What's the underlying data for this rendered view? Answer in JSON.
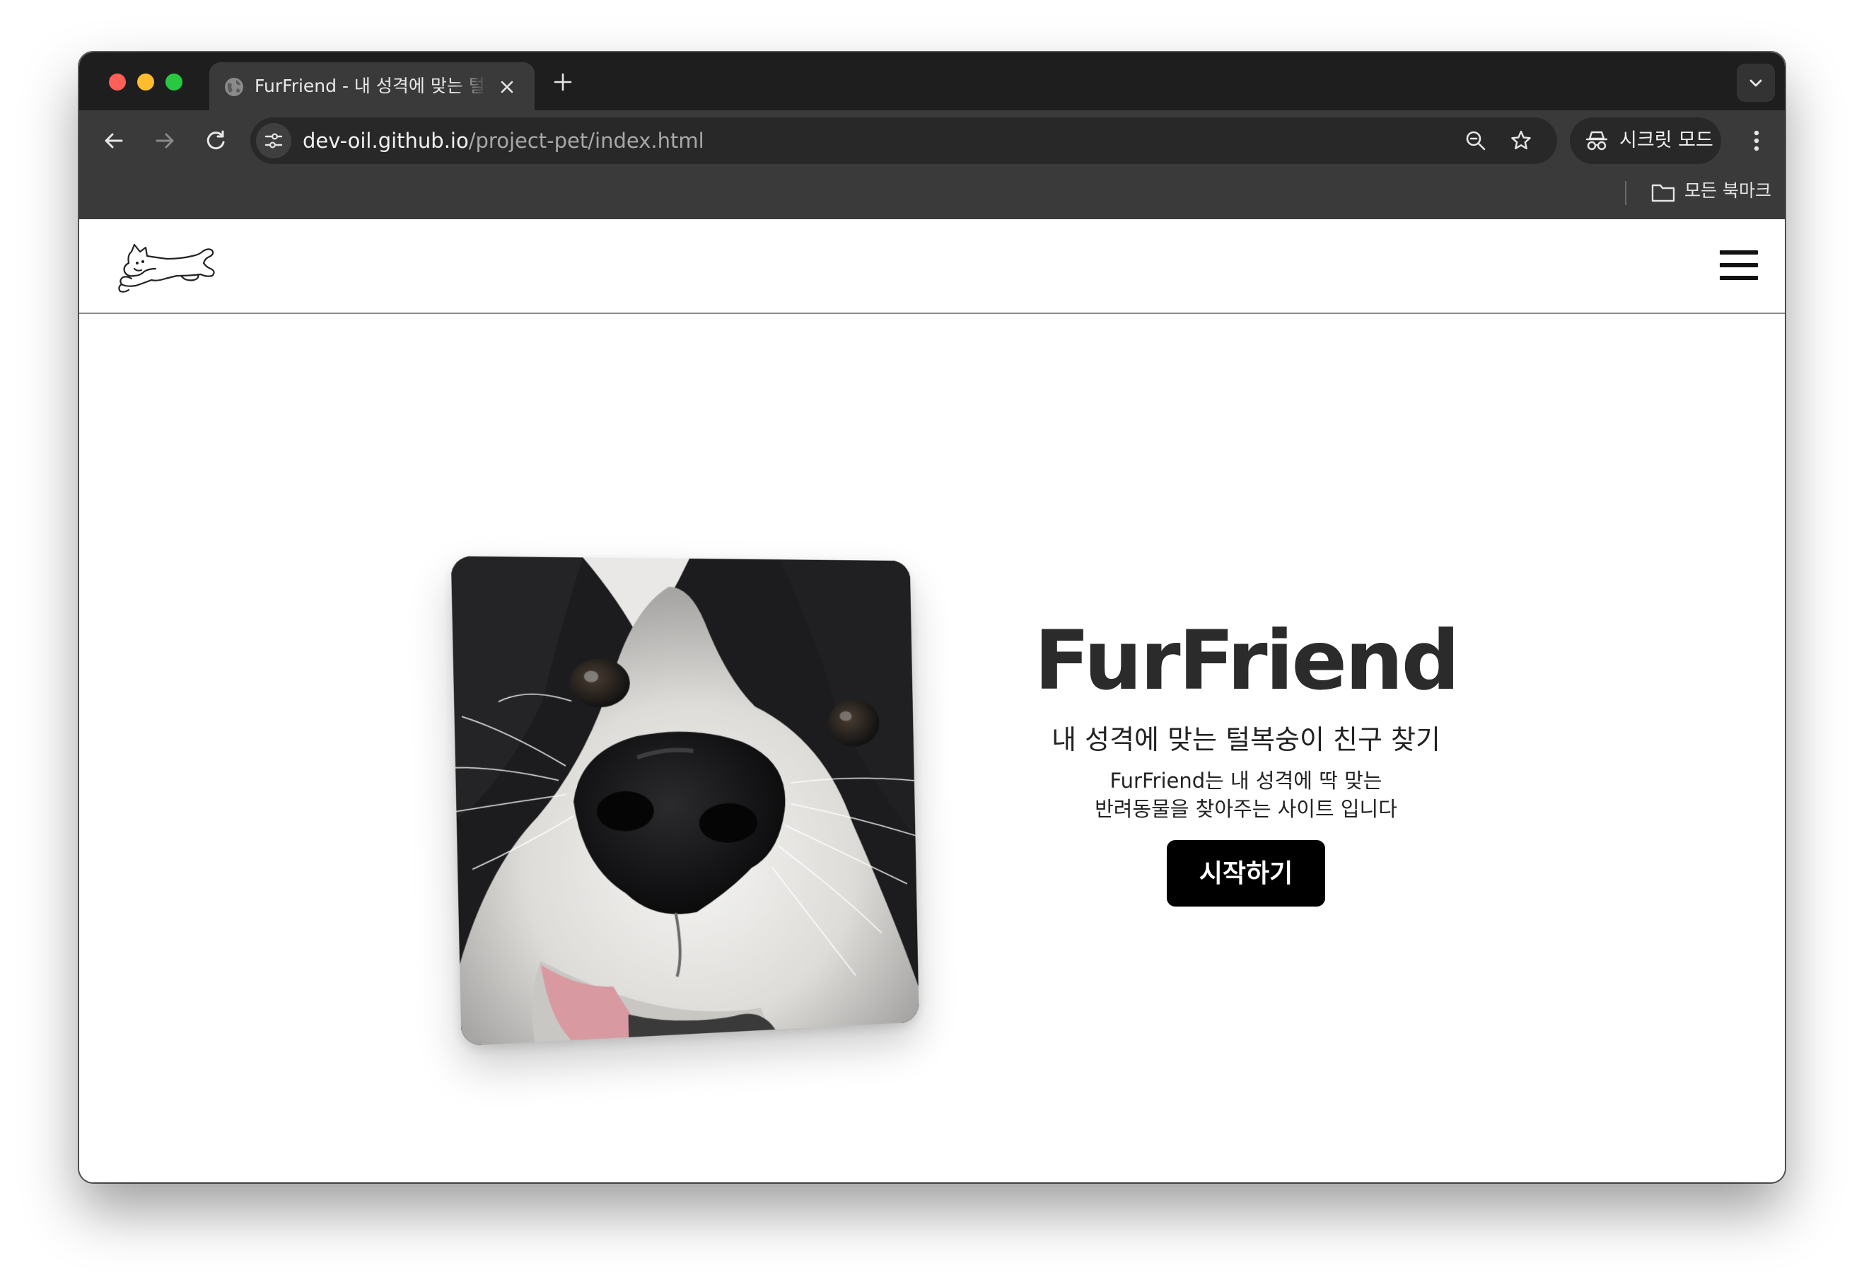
{
  "browser": {
    "tab": {
      "title": "FurFriend - 내 성격에 맞는 털복숭이 친구 찾기",
      "favicon": "globe-icon"
    },
    "url": {
      "host": "dev-oil.github.io",
      "path": "/project-pet/index.html"
    },
    "incognito_label": "시크릿 모드",
    "bookmarks": {
      "all_bookmarks_label": "모든 북마크"
    },
    "colors": {
      "tabstrip": "#1e1e1e",
      "toolbar": "#3a3a3a",
      "omnibox": "#282828"
    }
  },
  "site": {
    "logo": "cat-logo-icon",
    "menu_icon": "hamburger-menu-icon",
    "hero": {
      "image": "border-collie-closeup-photo",
      "title": "FurFriend",
      "subtitle": "내 성격에 맞는 털복숭이 친구 찾기",
      "description_line1": "FurFriend는 내 성격에 딱 맞는",
      "description_line2": "반려동물을 찾아주는 사이트 입니다",
      "cta_label": "시작하기"
    },
    "colors": {
      "cta_bg": "#000000",
      "cta_text": "#ffffff",
      "title": "#2b2b2b"
    }
  }
}
